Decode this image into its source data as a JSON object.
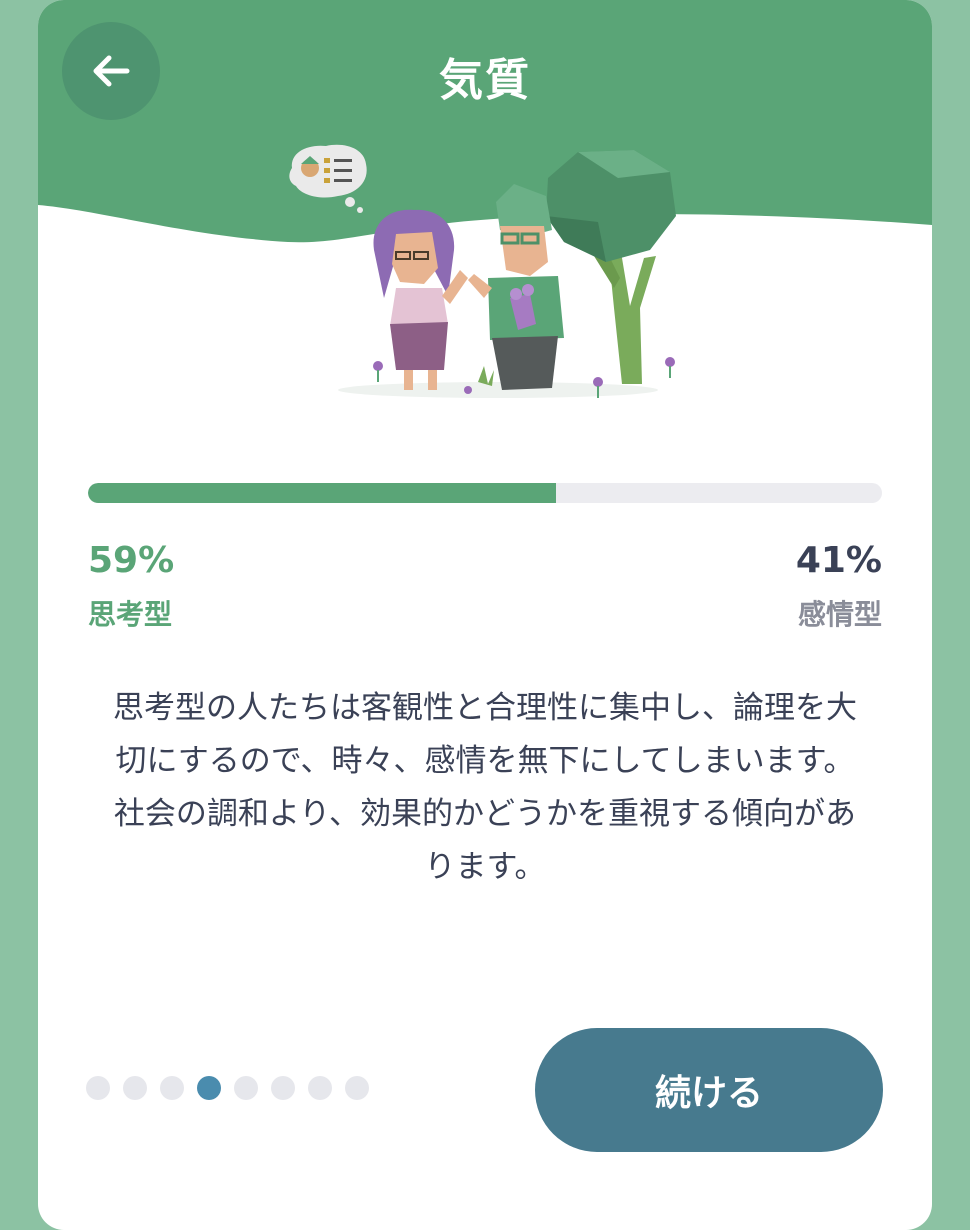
{
  "header": {
    "title": "気質",
    "back_icon": "arrow-left-icon"
  },
  "colors": {
    "header_green": "#5aa577",
    "thinking_green": "#5aa577",
    "feeling_text": "#3a4156",
    "button_teal": "#477a8e",
    "active_dot": "#4a8cae"
  },
  "trait": {
    "progress": 59,
    "left": {
      "percent": "59%",
      "label": "思考型"
    },
    "right": {
      "percent": "41%",
      "label": "感情型"
    }
  },
  "description": "思考型の人たちは客観性と合理性に集中し、論理を大切にするので、時々、感情を無下にしてしまいます。社会の調和より、効果的かどうかを重視する傾向があります。",
  "pagination": {
    "total": 8,
    "active_index": 3
  },
  "continue_label": "続ける"
}
